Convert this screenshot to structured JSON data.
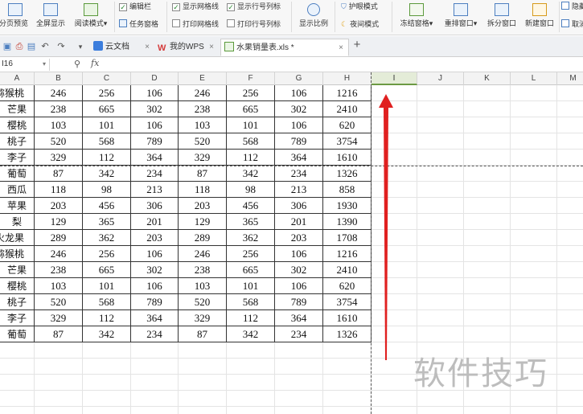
{
  "ribbon": {
    "page_preview": "分页预览",
    "full_screen": "全屏显示",
    "reading_mode": "阅读模式",
    "edit_bar": "编辑栏",
    "task_pane": "任务窗格",
    "show_gridlines": "显示网格线",
    "show_row_col_labels": "显示行号列标",
    "print_gridlines": "打印网格线",
    "print_row_col_labels": "打印行号列标",
    "zoom_ratio": "显示比例",
    "eye_protection": "护眼模式",
    "night_mode": "夜间模式",
    "freeze_panes": "冻结窗格",
    "rearrange_windows": "重排窗口",
    "split_window": "拆分窗口",
    "new_window": "新建窗口",
    "cut_right_top": "隐藏",
    "cut_right_bottom": "取消"
  },
  "tabs": [
    {
      "label": "云文档"
    },
    {
      "label": "我的WPS"
    },
    {
      "label": "水果销量表.xls *"
    }
  ],
  "formula_bar": {
    "name_box": "I16",
    "fx": "fx"
  },
  "columns": [
    "A",
    "B",
    "C",
    "D",
    "E",
    "F",
    "G",
    "H",
    "I",
    "J",
    "K",
    "L",
    "M"
  ],
  "rows": [
    [
      "猕猴桃",
      "246",
      "256",
      "106",
      "246",
      "256",
      "106",
      "1216"
    ],
    [
      "芒果",
      "238",
      "665",
      "302",
      "238",
      "665",
      "302",
      "2410"
    ],
    [
      "樱桃",
      "103",
      "101",
      "106",
      "103",
      "101",
      "106",
      "620"
    ],
    [
      "桃子",
      "520",
      "568",
      "789",
      "520",
      "568",
      "789",
      "3754"
    ],
    [
      "李子",
      "329",
      "112",
      "364",
      "329",
      "112",
      "364",
      "1610"
    ],
    [
      "葡萄",
      "87",
      "342",
      "234",
      "87",
      "342",
      "234",
      "1326"
    ],
    [
      "西瓜",
      "118",
      "98",
      "213",
      "118",
      "98",
      "213",
      "858"
    ],
    [
      "苹果",
      "203",
      "456",
      "306",
      "203",
      "456",
      "306",
      "1930"
    ],
    [
      "梨",
      "129",
      "365",
      "201",
      "129",
      "365",
      "201",
      "1390"
    ],
    [
      "火龙果",
      "289",
      "362",
      "203",
      "289",
      "362",
      "203",
      "1708"
    ],
    [
      "猕猴桃",
      "246",
      "256",
      "106",
      "246",
      "256",
      "106",
      "1216"
    ],
    [
      "芒果",
      "238",
      "665",
      "302",
      "238",
      "665",
      "302",
      "2410"
    ],
    [
      "樱桃",
      "103",
      "101",
      "106",
      "103",
      "101",
      "106",
      "620"
    ],
    [
      "桃子",
      "520",
      "568",
      "789",
      "520",
      "568",
      "789",
      "3754"
    ],
    [
      "李子",
      "329",
      "112",
      "364",
      "329",
      "112",
      "364",
      "1610"
    ],
    [
      "葡萄",
      "87",
      "342",
      "234",
      "87",
      "342",
      "234",
      "1326"
    ]
  ],
  "watermark": "软件技巧",
  "colors": {
    "arrow": "#e02020",
    "selected_col": "#e4ecd8",
    "accent": "#6c9a43"
  }
}
